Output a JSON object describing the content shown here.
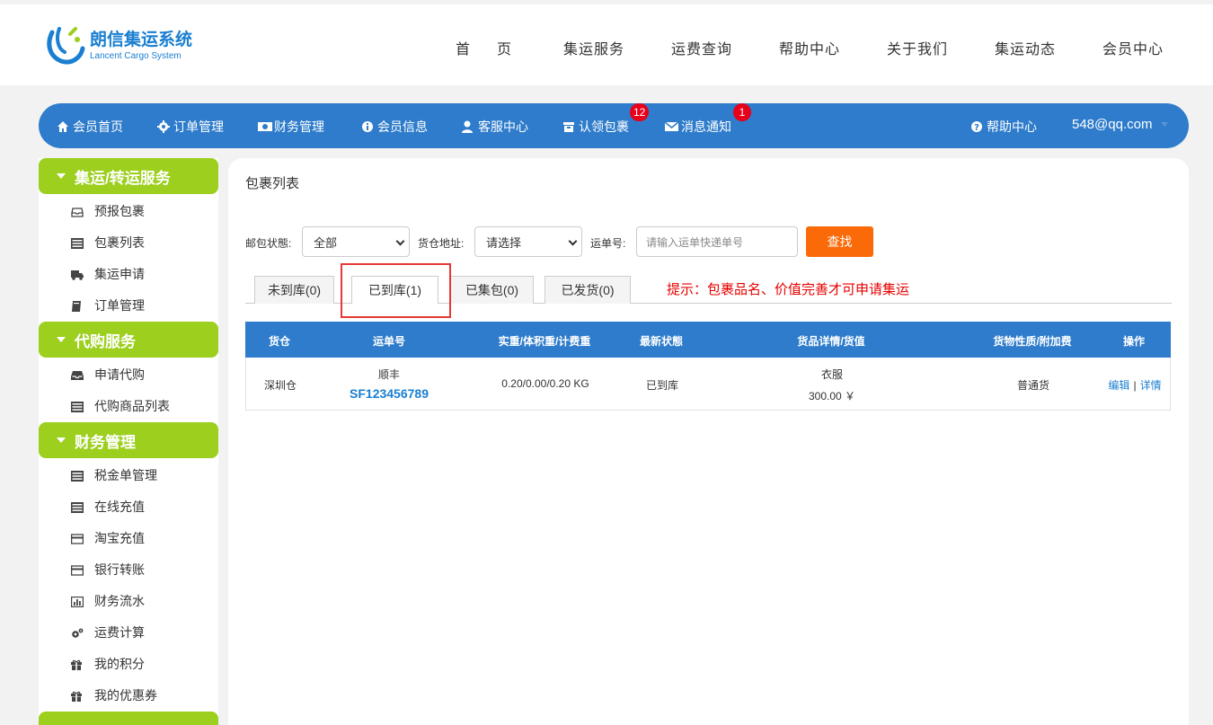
{
  "brand": {
    "title": "朗信集运系统",
    "subtitle": "Lancent Cargo System",
    "colors": {
      "primary": "#2e7ccb",
      "accent_green": "#9ccf1e",
      "button_orange": "#fb6a09",
      "badge_red": "#e6001a"
    }
  },
  "main_nav": [
    "首页",
    "集运服务",
    "运费查询",
    "帮助中心",
    "关于我们",
    "集运动态",
    "会员中心"
  ],
  "member_bar": {
    "items": [
      {
        "label": "会员首页",
        "icon": "home-icon"
      },
      {
        "label": "订单管理",
        "icon": "gear-icon"
      },
      {
        "label": "财务管理",
        "icon": "money-icon"
      },
      {
        "label": "会员信息",
        "icon": "info-icon"
      },
      {
        "label": "客服中心",
        "icon": "user-icon"
      },
      {
        "label": "认领包裹",
        "icon": "box-icon",
        "badge": "12"
      },
      {
        "label": "消息通知",
        "icon": "envelope-icon",
        "badge": "1"
      }
    ],
    "help": {
      "label": "帮助中心",
      "icon": "question-icon"
    },
    "account": "548@qq.com"
  },
  "sidebar": {
    "sections": [
      {
        "title": "集运/转运服务",
        "items": [
          {
            "label": "预报包裹",
            "icon": "inbox-icon"
          },
          {
            "label": "包裹列表",
            "icon": "list-icon"
          },
          {
            "label": "集运申请",
            "icon": "truck-icon"
          },
          {
            "label": "订单管理",
            "icon": "book-icon"
          }
        ]
      },
      {
        "title": "代购服务",
        "items": [
          {
            "label": "申请代购",
            "icon": "tray-icon"
          },
          {
            "label": "代购商品列表",
            "icon": "list-icon"
          }
        ]
      },
      {
        "title": "财务管理",
        "items": [
          {
            "label": "税金单管理",
            "icon": "list-icon"
          },
          {
            "label": "在线充值",
            "icon": "list-icon"
          },
          {
            "label": "淘宝充值",
            "icon": "card-icon"
          },
          {
            "label": "银行转账",
            "icon": "card-icon"
          },
          {
            "label": "财务流水",
            "icon": "chart-icon"
          },
          {
            "label": "运费计算",
            "icon": "cogs-icon"
          },
          {
            "label": "我的积分",
            "icon": "gift-icon"
          },
          {
            "label": "我的优惠券",
            "icon": "gift-icon"
          }
        ]
      }
    ]
  },
  "panel": {
    "title": "包裹列表",
    "filters": {
      "status_label": "邮包状態:",
      "status_value": "全部",
      "warehouse_label": "货仓地址:",
      "warehouse_value": "请选择",
      "tracking_label": "运单号:",
      "tracking_placeholder": "请输入运单快递单号",
      "search_button": "查找"
    },
    "tabs": [
      "未到库(0)",
      "已到库(1)",
      "已集包(0)",
      "已发货(0)"
    ],
    "active_tab": "已到库(1)",
    "hint": "提示：包裹品名、价值完善才可申请集运",
    "table": {
      "headers": [
        "货仓",
        "运单号",
        "实重/体积重/计费重",
        "最新状態",
        "货品详情/货值",
        "货物性质/附加费",
        "操作"
      ],
      "rows": [
        {
          "warehouse": "深圳仓",
          "carrier": "顺丰",
          "tracking_no": "SF123456789",
          "weights": "0.20/0.00/0.20 KG",
          "status": "已到库",
          "goods": "衣服",
          "value": "300.00 ￥",
          "nature": "普通货",
          "actions": {
            "edit": "编辑",
            "separator": "|",
            "detail": "详情"
          }
        }
      ]
    }
  }
}
